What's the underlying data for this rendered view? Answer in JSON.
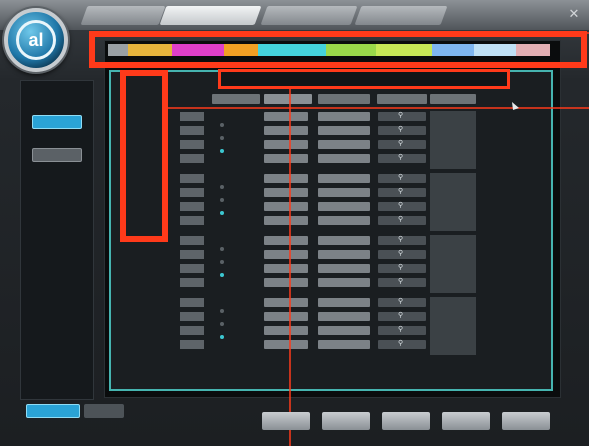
{
  "tabs": [
    {
      "label": ""
    },
    {
      "label": ""
    },
    {
      "label": ""
    },
    {
      "label": ""
    }
  ],
  "logo": {
    "text": "al"
  },
  "sidebar": {
    "buttons": [
      {
        "label": ""
      },
      {
        "label": ""
      }
    ]
  },
  "color_strip": [
    {
      "label": "",
      "color": "#9aa0a4"
    },
    {
      "label": "",
      "color": "#e6b43c"
    },
    {
      "label": "",
      "color": "#e03fc9"
    },
    {
      "label": "",
      "color": "#f2a024"
    },
    {
      "label": "",
      "color": "#44d3dc"
    },
    {
      "label": "",
      "color": "#9ad84a"
    },
    {
      "label": "",
      "color": "#c7e856"
    },
    {
      "label": "",
      "color": "#7fb6f0"
    },
    {
      "label": "",
      "color": "#bfe0f5"
    },
    {
      "label": "",
      "color": "#e2aeb3"
    }
  ],
  "columns": [
    "",
    "",
    "",
    "",
    ""
  ],
  "groups": [
    {
      "channels": [
        "",
        "",
        "",
        ""
      ],
      "radio": [
        "",
        "",
        ""
      ],
      "selected": 2,
      "spec": [
        "",
        ""
      ]
    },
    {
      "channels": [
        "",
        "",
        "",
        ""
      ],
      "radio": [
        "",
        "",
        ""
      ],
      "selected": 2,
      "spec": [
        "",
        ""
      ]
    },
    {
      "channels": [
        "",
        "",
        "",
        ""
      ],
      "radio": [
        "",
        "",
        ""
      ],
      "selected": 2,
      "spec": [
        "",
        ""
      ]
    },
    {
      "channels": [
        "",
        "",
        "",
        ""
      ],
      "radio": [
        "",
        "",
        ""
      ],
      "selected": 2,
      "spec": [
        "",
        ""
      ]
    }
  ],
  "bottom_tabs": [
    {
      "label": ""
    },
    {
      "label": ""
    }
  ],
  "bottom_buttons": [
    {
      "label": ""
    },
    {
      "label": ""
    },
    {
      "label": ""
    },
    {
      "label": ""
    },
    {
      "label": ""
    }
  ]
}
